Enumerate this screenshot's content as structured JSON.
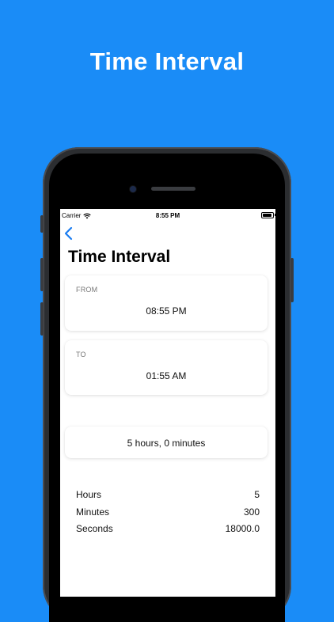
{
  "promo": {
    "title": "Time Interval"
  },
  "status_bar": {
    "carrier": "Carrier",
    "time": "8:55 PM"
  },
  "nav": {
    "back_icon": "chevron-left-icon",
    "title": "Time Interval"
  },
  "from": {
    "label": "FROM",
    "value": "08:55 PM"
  },
  "to": {
    "label": "TO",
    "value": "01:55 AM"
  },
  "result": {
    "text": "5 hours, 0 minutes"
  },
  "stats": [
    {
      "label": "Hours",
      "value": "5"
    },
    {
      "label": "Minutes",
      "value": "300"
    },
    {
      "label": "Seconds",
      "value": "18000.0"
    }
  ],
  "colors": {
    "background": "#1a8cf7",
    "accent": "#1a7cf0"
  }
}
